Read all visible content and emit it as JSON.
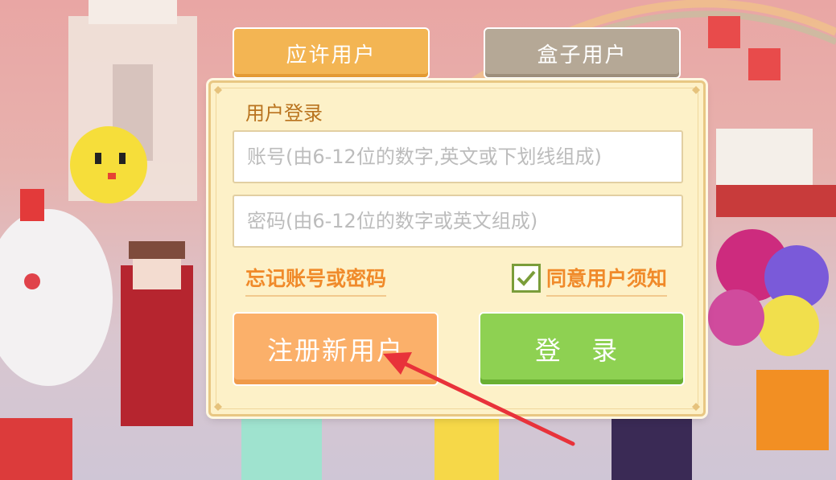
{
  "tabs": {
    "active_label": "应许用户",
    "inactive_label": "盒子用户"
  },
  "login": {
    "title": "用户登录",
    "account_placeholder": "账号(由6-12位的数字,英文或下划线组成)",
    "password_placeholder": "密码(由6-12位的数字或英文组成)",
    "forgot_link": "忘记账号或密码",
    "agree_label": "同意用户须知",
    "agree_checked": true,
    "register_button": "注册新用户",
    "login_button": "登 录"
  },
  "icons": {
    "checkbox": "check-icon",
    "annotation": "red-arrow-icon"
  },
  "colors": {
    "active_tab": "#f3b553",
    "inactive_tab": "#b5a896",
    "register": "#fbb06a",
    "login": "#8ed152",
    "accent_text": "#f08a2a",
    "arrow": "#e8323a"
  }
}
